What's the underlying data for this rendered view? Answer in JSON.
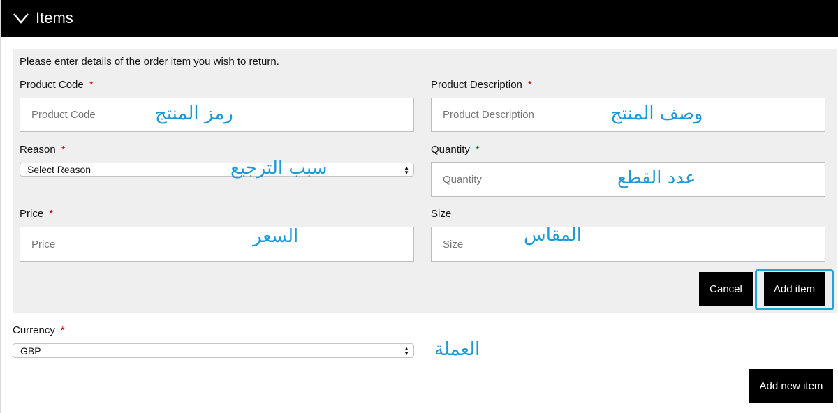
{
  "header": {
    "title": "Items",
    "icon": "chevron-down-icon"
  },
  "form": {
    "intro": "Please enter details of the order item you wish to return.",
    "required_mark": "*",
    "product_code": {
      "label": "Product Code",
      "placeholder": "Product Code",
      "annotation": "رمز المنتج"
    },
    "product_description": {
      "label": "Product Description",
      "placeholder": "Product Description",
      "annotation": "وصف المنتج"
    },
    "reason": {
      "label": "Reason",
      "value": "Select Reason",
      "annotation": "سبب الترجيع"
    },
    "quantity": {
      "label": "Quantity",
      "placeholder": "Quantity",
      "annotation": "عدد القطع"
    },
    "price": {
      "label": "Price",
      "placeholder": "Price",
      "annotation": "السعر"
    },
    "size": {
      "label": "Size",
      "placeholder": "Size",
      "annotation": "المقاس"
    },
    "cancel_label": "Cancel",
    "add_item_label": "Add item"
  },
  "currency": {
    "label": "Currency",
    "value": "GBP",
    "annotation": "العملة"
  },
  "add_new_item_label": "Add new item",
  "colors": {
    "header_bg": "#000000",
    "panel_bg": "#efefef",
    "annotation": "#1d9ad6",
    "highlight": "#1ea6dc",
    "required": "#d40000"
  }
}
